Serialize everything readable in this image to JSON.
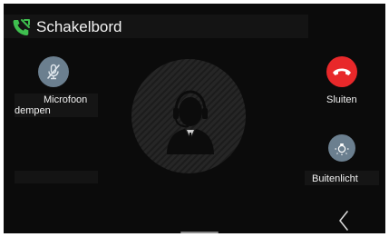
{
  "header": {
    "title": "Schakelbord",
    "icon": "phone-call-icon",
    "icon_color": "#3fbf4f"
  },
  "buttons": {
    "mute": {
      "label_line1": "Microfoon",
      "label_line2": "dempen",
      "icon": "mic-off-icon",
      "color": "#6b7f8f"
    },
    "hangup": {
      "label": "Sluiten",
      "icon": "hang-up-icon",
      "color": "#e8282a"
    },
    "outdoor_light": {
      "label": "Buitenlicht",
      "icon": "light-bulb-icon",
      "color": "#6b7f8f"
    }
  },
  "caller": {
    "avatar_icon": "operator-headset-icon"
  },
  "navigation": {
    "back_icon": "chevron-left-icon"
  }
}
